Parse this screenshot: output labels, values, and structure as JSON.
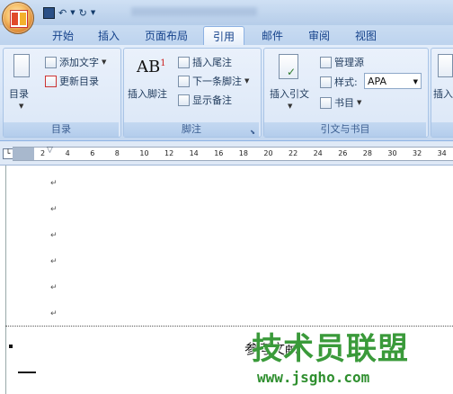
{
  "tabs": [
    "开始",
    "插入",
    "页面布局",
    "引用",
    "邮件",
    "审阅",
    "视图"
  ],
  "active_tab": "引用",
  "group_toc": {
    "big_label": "目录",
    "add_text": "添加文字",
    "update_toc": "更新目录",
    "label": "目录"
  },
  "group_footnote": {
    "big_label": "插入脚注",
    "ab_glyph": "AB",
    "sup_glyph": "1",
    "insert_endnote": "插入尾注",
    "next_footnote": "下一条脚注",
    "show_notes": "显示备注",
    "label": "脚注"
  },
  "group_citation": {
    "big_label": "插入引文",
    "manage_sources": "管理源",
    "style_label": "样式:",
    "style_value": "APA",
    "bibliography": "书目",
    "label": "引文与书目"
  },
  "group_caption_partial": "插入",
  "ruler_ticks": [
    "2",
    "4",
    "6",
    "8",
    "10",
    "12",
    "14",
    "16",
    "18",
    "20",
    "22",
    "24",
    "26",
    "28",
    "30",
    "32",
    "34"
  ],
  "paragraph_mark": "↵",
  "document": {
    "references_heading": "参考文献"
  },
  "watermark": {
    "title": "技术员联盟",
    "url": "www.jsgho.com"
  },
  "colors": {
    "ribbon_bg": "#dbe7f7",
    "tab_text": "#15428b",
    "watermark_green": "#3a9a3a"
  }
}
